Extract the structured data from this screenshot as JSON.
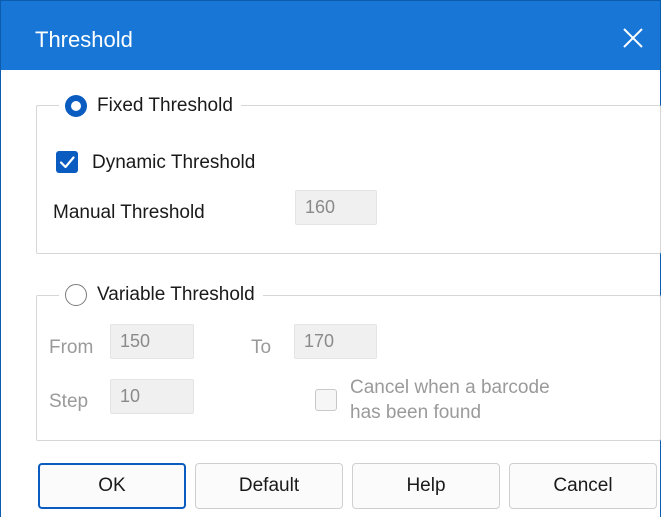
{
  "dialog": {
    "title": "Threshold"
  },
  "fixed_group": {
    "label": "Fixed Threshold",
    "selected": true,
    "dynamic": {
      "label": "Dynamic Threshold",
      "checked": true
    },
    "manual": {
      "label": "Manual Threshold",
      "value": "160"
    }
  },
  "variable_group": {
    "label": "Variable Threshold",
    "selected": false,
    "from": {
      "label": "From",
      "value": "150"
    },
    "to": {
      "label": "To",
      "value": "170"
    },
    "step": {
      "label": "Step",
      "value": "10"
    },
    "cancel_found": {
      "label_line1": "Cancel when a barcode",
      "label_line2": "has been found",
      "checked": false
    }
  },
  "buttons": {
    "ok": "OK",
    "default": "Default",
    "help": "Help",
    "cancel": "Cancel"
  },
  "colors": {
    "title_bar": "#1877d6",
    "accent": "#0a5cc0"
  },
  "icons": {
    "close": "close-icon",
    "check": "checkmark-icon"
  }
}
